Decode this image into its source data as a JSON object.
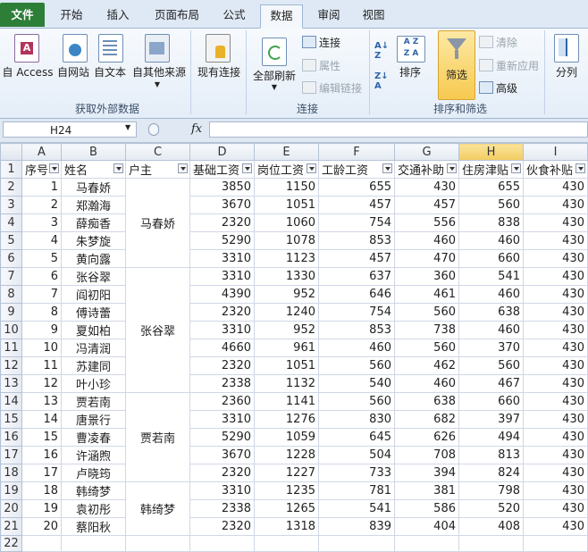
{
  "tabs": [
    "文件",
    "开始",
    "插入",
    "页面布局",
    "公式",
    "数据",
    "审阅",
    "视图"
  ],
  "ribbon": {
    "get_external": {
      "buttons": [
        "自 Access",
        "自网站",
        "自文本",
        "自其他来源"
      ],
      "label": "获取外部数据"
    },
    "existing_connections": "现有连接",
    "connections": {
      "refresh_all": "全部刷新",
      "connections": "连接",
      "properties": "属性",
      "edit_links": "编辑链接",
      "label": "连接"
    },
    "sort_filter": {
      "sort": "排序",
      "filter": "筛选",
      "clear": "清除",
      "reapply": "重新应用",
      "advanced": "高级",
      "label": "排序和筛选"
    },
    "outline": {
      "split": "分列"
    }
  },
  "formula_bar": {
    "cell_ref": "H24",
    "fx": "fx",
    "value": ""
  },
  "columns": [
    "A",
    "B",
    "C",
    "D",
    "E",
    "F",
    "G",
    "H",
    "I"
  ],
  "headers": [
    "序号",
    "姓名",
    "户主",
    "基础工资",
    "岗位工资",
    "工龄工资",
    "交通补助",
    "住房津贴",
    "伙食补贴"
  ],
  "owners": [
    {
      "name": "马春娇",
      "rows": 5
    },
    {
      "name": "张谷翠",
      "rows": 7
    },
    {
      "name": "贾若南",
      "rows": 5
    },
    {
      "name": "韩绮梦",
      "rows": 3
    }
  ],
  "rows": [
    [
      "1",
      "马春娇",
      "3850",
      "1150",
      "655",
      "430",
      "655",
      "430"
    ],
    [
      "2",
      "郑瀚海",
      "3670",
      "1051",
      "457",
      "457",
      "560",
      "430"
    ],
    [
      "3",
      "薛痴香",
      "2320",
      "1060",
      "754",
      "556",
      "838",
      "430"
    ],
    [
      "4",
      "朱梦旋",
      "5290",
      "1078",
      "853",
      "460",
      "460",
      "430"
    ],
    [
      "5",
      "黄向露",
      "3310",
      "1123",
      "457",
      "470",
      "660",
      "430"
    ],
    [
      "6",
      "张谷翠",
      "3310",
      "1330",
      "637",
      "360",
      "541",
      "430"
    ],
    [
      "7",
      "阎初阳",
      "4390",
      "952",
      "646",
      "461",
      "460",
      "430"
    ],
    [
      "8",
      "傅诗蕾",
      "2320",
      "1240",
      "754",
      "560",
      "638",
      "430"
    ],
    [
      "9",
      "夏如柏",
      "3310",
      "952",
      "853",
      "738",
      "460",
      "430"
    ],
    [
      "10",
      "冯清润",
      "4660",
      "961",
      "460",
      "560",
      "370",
      "430"
    ],
    [
      "11",
      "苏建同",
      "2320",
      "1051",
      "560",
      "462",
      "560",
      "430"
    ],
    [
      "12",
      "叶小珍",
      "2338",
      "1132",
      "540",
      "460",
      "467",
      "430"
    ],
    [
      "13",
      "贾若南",
      "2360",
      "1141",
      "560",
      "638",
      "660",
      "430"
    ],
    [
      "14",
      "唐景行",
      "3310",
      "1276",
      "830",
      "682",
      "397",
      "430"
    ],
    [
      "15",
      "曹凌春",
      "5290",
      "1059",
      "645",
      "626",
      "494",
      "430"
    ],
    [
      "16",
      "许涵煦",
      "3670",
      "1228",
      "504",
      "708",
      "813",
      "430"
    ],
    [
      "17",
      "卢晓筠",
      "2320",
      "1227",
      "733",
      "394",
      "824",
      "430"
    ],
    [
      "18",
      "韩绮梦",
      "3310",
      "1235",
      "781",
      "381",
      "798",
      "430"
    ],
    [
      "19",
      "袁初彤",
      "2338",
      "1265",
      "541",
      "586",
      "520",
      "430"
    ],
    [
      "20",
      "蔡阳秋",
      "2320",
      "1318",
      "839",
      "404",
      "408",
      "430"
    ]
  ],
  "row_numbers": [
    "1",
    "2",
    "3",
    "4",
    "5",
    "6",
    "7",
    "8",
    "9",
    "10",
    "11",
    "12",
    "13",
    "14",
    "15",
    "16",
    "17",
    "18",
    "19",
    "20",
    "21",
    "22"
  ]
}
